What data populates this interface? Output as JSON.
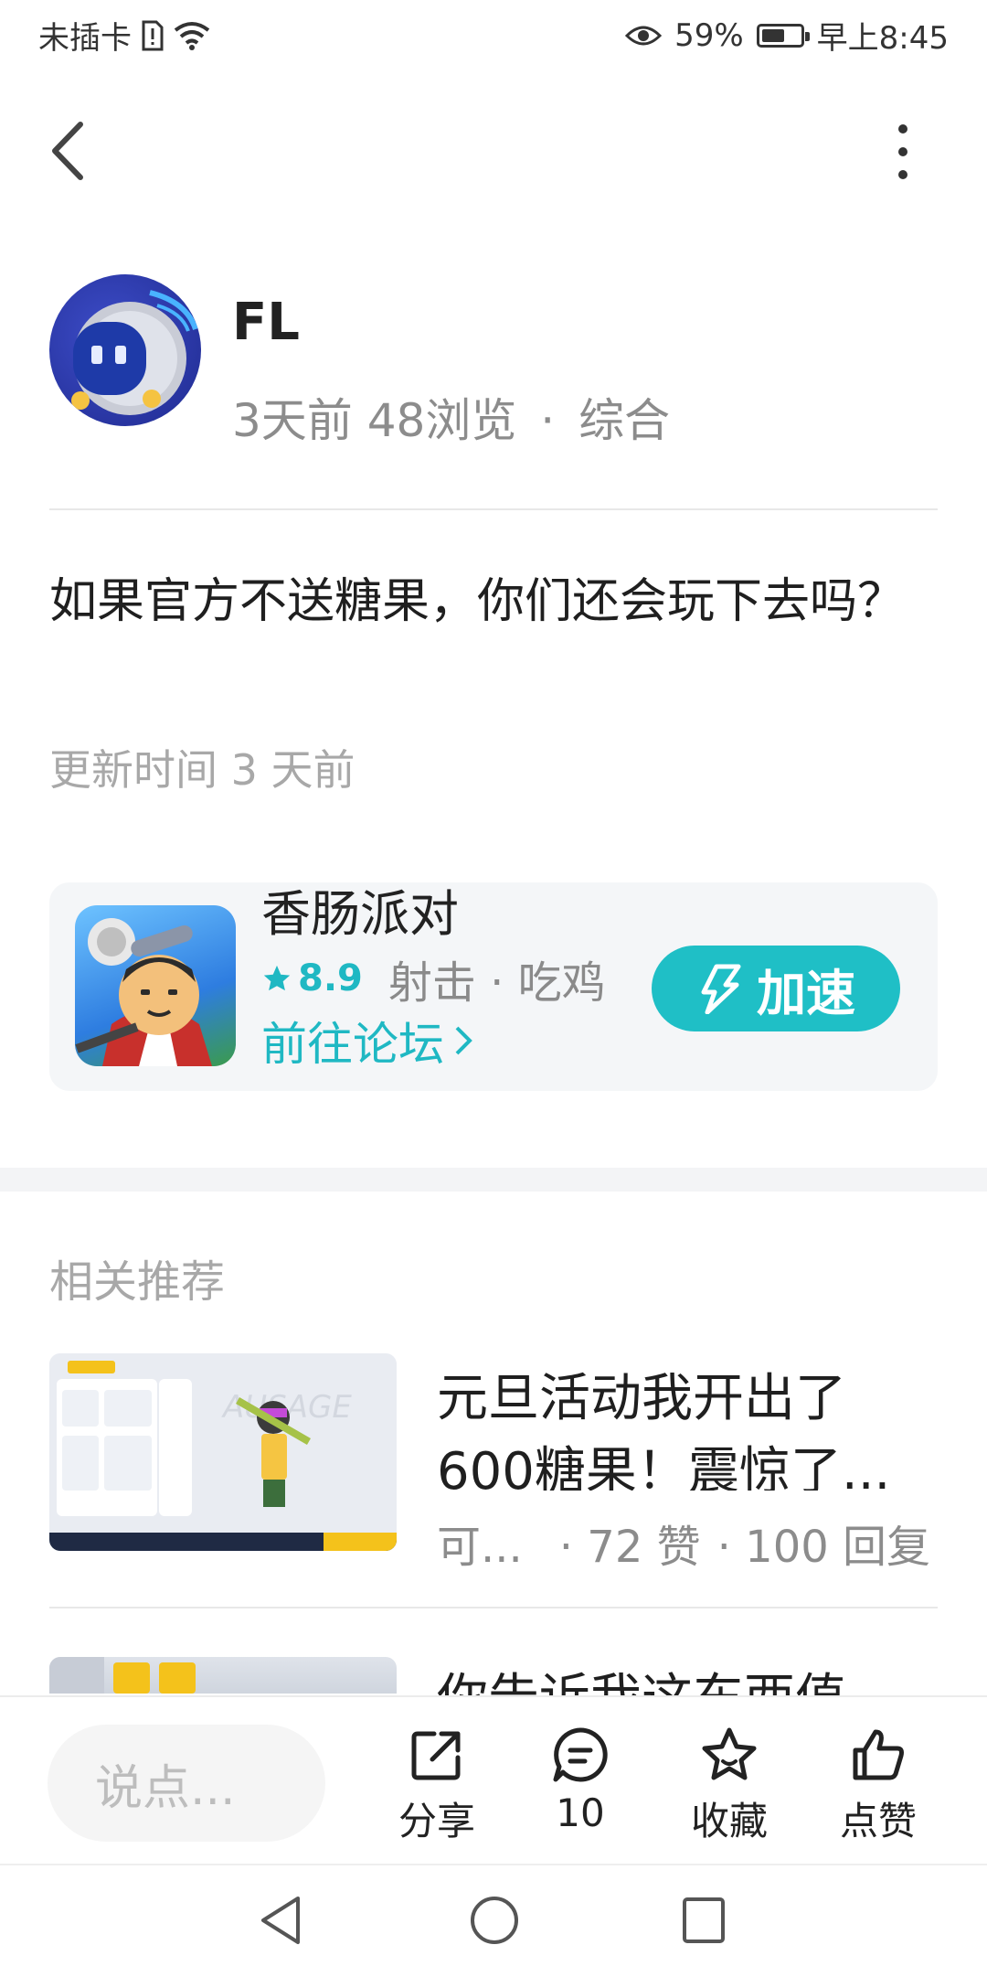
{
  "status_bar": {
    "carrier": "未插卡",
    "battery": "59%",
    "battery_level": 0.59,
    "time": "早上8:45"
  },
  "post": {
    "author": "FL",
    "time_ago": "3天前",
    "views": "48浏览",
    "separator": "·",
    "category": "综合",
    "content": "如果官方不送糖果，你们还会玩下去吗？",
    "updated": "更新时间 3 天前"
  },
  "game": {
    "name": "香肠派对",
    "rating": "8.9",
    "tags": "射击 · 吃鸡",
    "forum_link": "前往论坛",
    "accelerate_label": "加速"
  },
  "related": {
    "title": "相关推荐",
    "items": [
      {
        "title": "元旦活动我开出了600糖果！震惊了...",
        "author": "可...",
        "likes": "· 72 赞",
        "replies": "· 100 回复"
      },
      {
        "title": "你告诉我这东西值"
      }
    ]
  },
  "action_bar": {
    "comment_placeholder": "说点...",
    "share": "分享",
    "comments": "10",
    "collect": "收藏",
    "like": "点赞"
  },
  "colors": {
    "accent": "#1fbfc6",
    "text_primary": "#1f1f1f",
    "text_secondary": "#8c8c8c"
  }
}
